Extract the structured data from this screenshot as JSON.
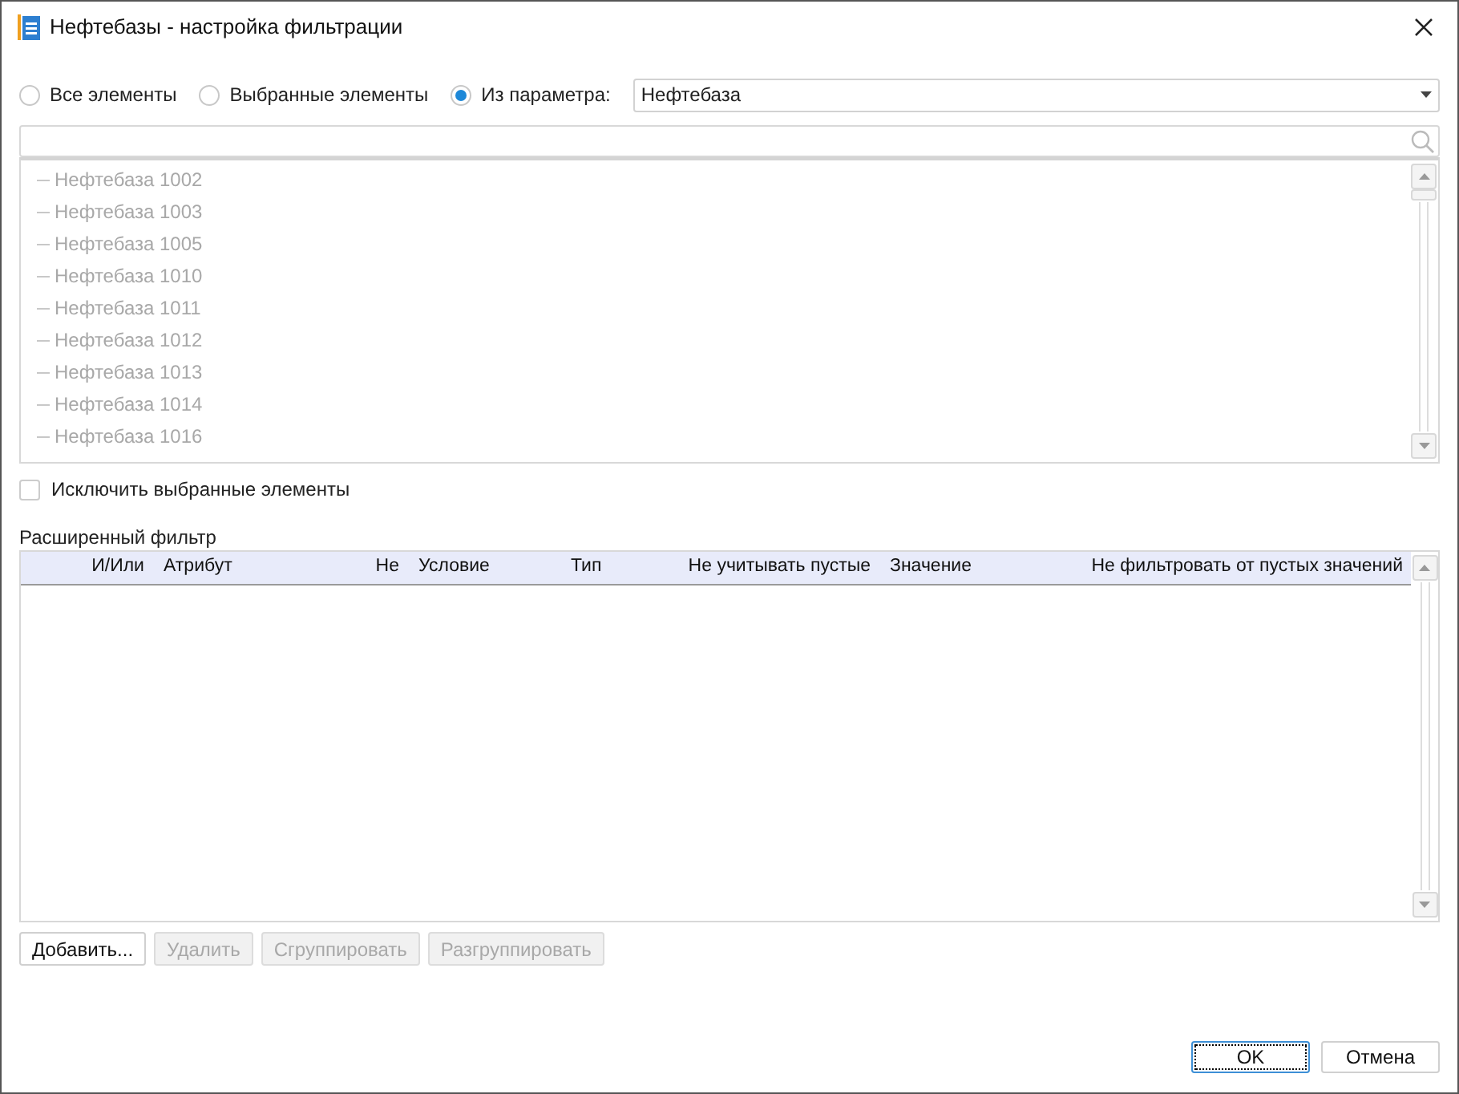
{
  "window": {
    "title": "Нефтебазы - настройка фильтрации"
  },
  "source_options": [
    {
      "label": "Все элементы",
      "selected": false
    },
    {
      "label": "Выбранные элементы",
      "selected": false
    },
    {
      "label": "Из параметра:",
      "selected": true
    }
  ],
  "parameter_select": {
    "value": "Нефтебаза"
  },
  "elements_list": {
    "disabled": true,
    "items": [
      "Нефтебаза 1002",
      "Нефтебаза 1003",
      "Нефтебаза 1005",
      "Нефтебаза 1010",
      "Нефтебаза 1011",
      "Нефтебаза 1012",
      "Нефтебаза 1013",
      "Нефтебаза 1014",
      "Нефтебаза 1016"
    ]
  },
  "exclude_selected": {
    "label": "Исключить выбранные элементы",
    "checked": false
  },
  "advanced_filter": {
    "title": "Расширенный фильтр",
    "columns": [
      "И/Или",
      "Атрибут",
      "Не",
      "Условие",
      "Тип",
      "Не учитывать пустые",
      "Значение",
      "Не фильтровать от пустых значений"
    ]
  },
  "filter_buttons": [
    {
      "label": "Добавить...",
      "disabled": false
    },
    {
      "label": "Удалить",
      "disabled": true
    },
    {
      "label": "Сгруппировать",
      "disabled": true
    },
    {
      "label": "Разгруппировать",
      "disabled": true
    }
  ],
  "dialog_buttons": [
    {
      "label": "OK",
      "default": true
    },
    {
      "label": "Отмена",
      "default": false
    }
  ]
}
